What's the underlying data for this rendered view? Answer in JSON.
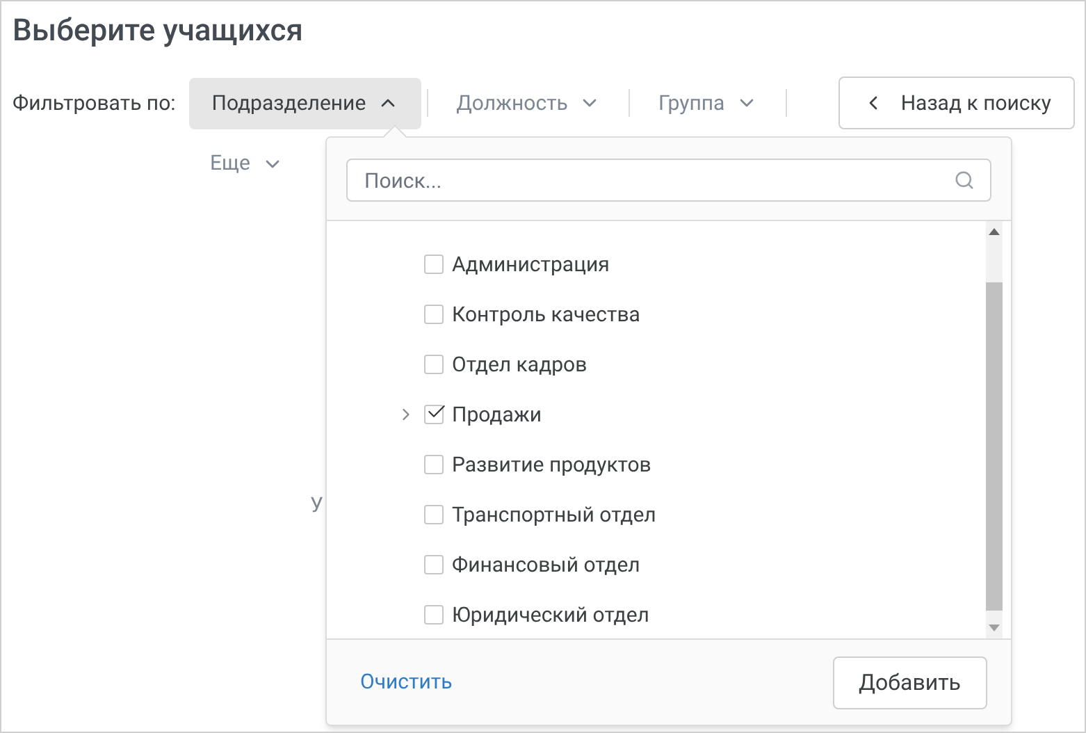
{
  "title": "Выберите учащихся",
  "filter": {
    "label": "Фильтровать по:",
    "options": [
      {
        "label": "Подразделение",
        "selected": true
      },
      {
        "label": "Должность",
        "selected": false
      },
      {
        "label": "Группа",
        "selected": false
      },
      {
        "label": "Еще",
        "selected": false
      }
    ]
  },
  "back_button": "Назад к поиску",
  "background_text": "У",
  "dropdown": {
    "search": {
      "placeholder": "Поиск..."
    },
    "items": [
      {
        "label": "Администрация",
        "checked": false,
        "expandable": false
      },
      {
        "label": "Контроль качества",
        "checked": false,
        "expandable": false
      },
      {
        "label": "Отдел кадров",
        "checked": false,
        "expandable": false
      },
      {
        "label": "Продажи",
        "checked": true,
        "expandable": true
      },
      {
        "label": "Развитие продуктов",
        "checked": false,
        "expandable": false
      },
      {
        "label": "Транспортный отдел",
        "checked": false,
        "expandable": false
      },
      {
        "label": "Финансовый отдел",
        "checked": false,
        "expandable": false
      },
      {
        "label": "Юридический отдел",
        "checked": false,
        "expandable": false
      }
    ],
    "clear_link": "Очистить",
    "add_button": "Добавить"
  }
}
